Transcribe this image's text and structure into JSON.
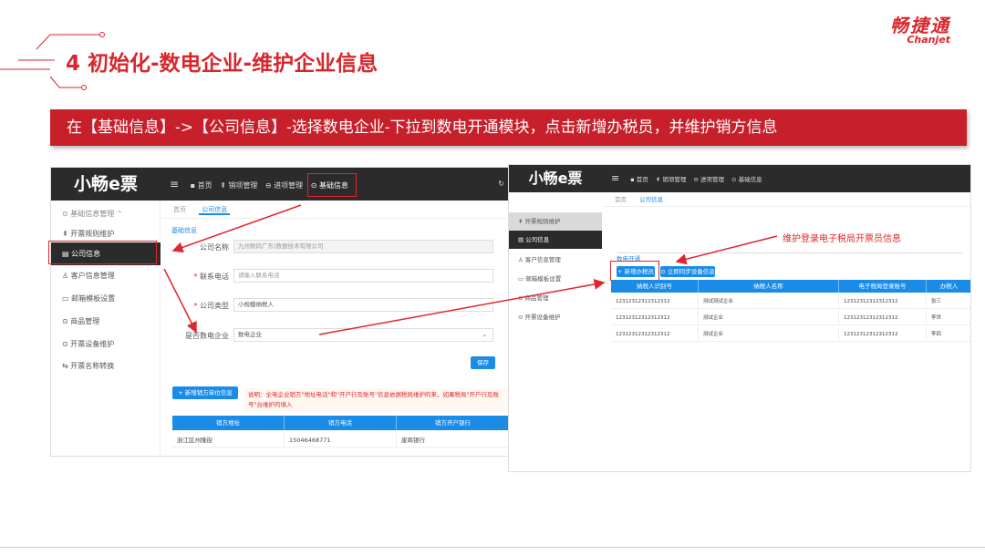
{
  "slide": {
    "title": "4  初始化-数电企业-维护企业信息",
    "logo_cn": "畅捷通",
    "logo_en": "Chanjet",
    "banner": "在【基础信息】->【公司信息】-选择数电企业-下拉到数电开通模块，点击新增办税员，并维护销方信息",
    "annotation": "维护登录电子税局开票员信息"
  },
  "shot1": {
    "logo": "小畅e票",
    "nav": [
      "首页",
      "销项管理",
      "进项管理",
      "基础信息"
    ],
    "sidebar_header": "基础信息管理",
    "menu": [
      "开票规则维护",
      "公司信息",
      "客户信息管理",
      "邮箱模板设置",
      "商品管理",
      "开票设备维护",
      "开票名称转换"
    ],
    "tabs": [
      "首页",
      "公司信息"
    ],
    "section": "基础信息",
    "form": {
      "company_label": "公司名称",
      "company_value": "九州数码广东(数据技术有限公司",
      "phone_label": "联系电话",
      "phone_placeholder": "请输入联系电话",
      "type_label": "公司类型",
      "type_value": "小规模纳税人",
      "digital_label": "是否数电企业",
      "digital_value": "数电企业"
    },
    "save": "保存",
    "add_seller": "+ 新增销方单位信息",
    "note": "说明：全电企业销方\"地址电话\"和\"开户行及账号\"信息依据税局维护的来，如果税局\"开户行及账号\"台维护的填入",
    "table_headers": [
      "销方地址",
      "销方电话",
      "销方开户银行"
    ],
    "table_rows": [
      [
        "浙江区州隆街",
        "15046468771",
        "崖商银行"
      ]
    ]
  },
  "shot2": {
    "logo": "小畅e票",
    "nav": [
      "首页",
      "销项管理",
      "进项管理",
      "基础信息"
    ],
    "menu": [
      "开票规则维护",
      "公司信息",
      "客户信息管理",
      "邮箱模板设置",
      "商品管理",
      "开票设备维护"
    ],
    "tabs": [
      "首页",
      "公司信息"
    ],
    "section": "数电开通",
    "add_tax_officer": "+ 新增办税员",
    "sync_btn": "立即同步设备信息",
    "table_headers": [
      "纳税人识别号",
      "纳税人名称",
      "电子税局登录账号",
      "办税人"
    ],
    "table_rows": [
      [
        "12312312312312312",
        "测试测试企业",
        "12312312312312312",
        "张三"
      ],
      [
        "12312312312312312",
        "测试企业",
        "12312312312312312",
        "李世"
      ],
      [
        "12312312312312312",
        "测试企业",
        "12312312312312312",
        "李四"
      ]
    ]
  }
}
